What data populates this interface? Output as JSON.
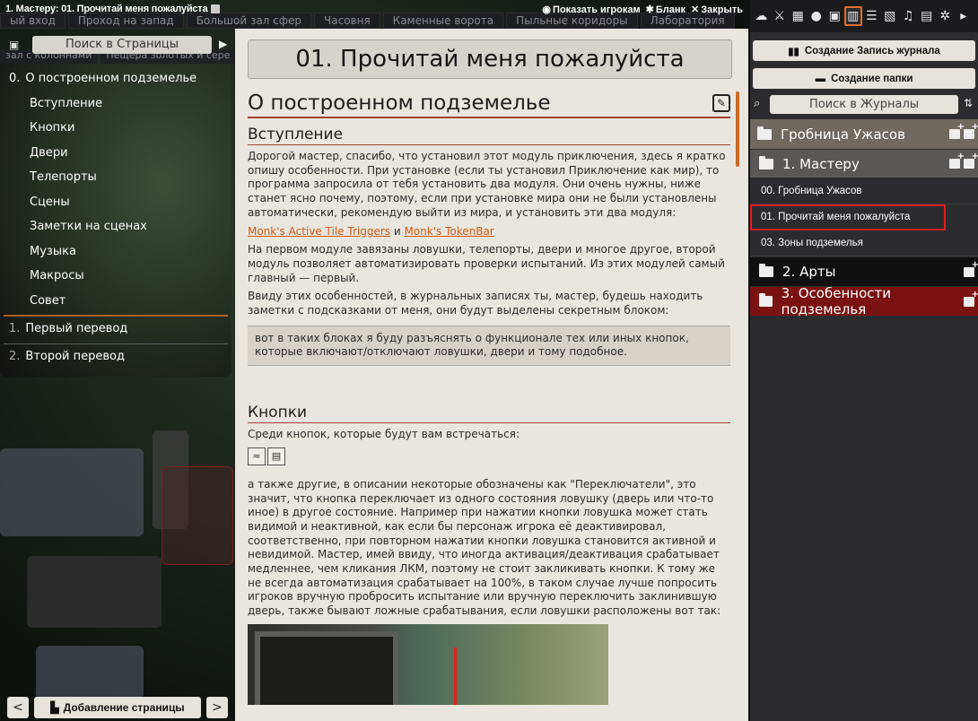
{
  "window": {
    "title": "1. Мастеру: 01. Прочитай меня пожалуйста",
    "actions": {
      "show_players": "Показать игрокам",
      "sheet": "Бланк",
      "close": "Закрыть"
    }
  },
  "scene_tabs": [
    "ый вход",
    "Проход на запад",
    "Большой зал сфер",
    "Часовня",
    "Каменные ворота",
    "Пыльные коридоры",
    "Лаборатория"
  ],
  "scene_tabs_row2": [
    "зал с колоннами",
    "Пещера золотых и сере"
  ],
  "toc": {
    "search_placeholder": "Поиск в Страницы",
    "items": [
      {
        "num": "0.",
        "label": "О построенном подземелье",
        "level": 0
      },
      {
        "num": "",
        "label": "Вступление",
        "level": 1
      },
      {
        "num": "",
        "label": "Кнопки",
        "level": 1
      },
      {
        "num": "",
        "label": "Двери",
        "level": 1
      },
      {
        "num": "",
        "label": "Телепорты",
        "level": 1
      },
      {
        "num": "",
        "label": "Сцены",
        "level": 1
      },
      {
        "num": "",
        "label": "Заметки на сценах",
        "level": 1
      },
      {
        "num": "",
        "label": "Музыка",
        "level": 1
      },
      {
        "num": "",
        "label": "Макросы",
        "level": 1
      },
      {
        "num": "",
        "label": "Совет",
        "level": 1
      }
    ],
    "pages": [
      {
        "num": "1.",
        "label": "Первый перевод"
      },
      {
        "num": "2.",
        "label": "Второй перевод"
      }
    ],
    "add_page": "Добавление страницы",
    "prev": "<",
    "next": ">"
  },
  "page": {
    "title": "01. Прочитай меня пожалуйста",
    "heading": "О построенном подземелье",
    "section1": "Вступление",
    "p1": "Дорогой мастер, спасибо, что установил этот модуль приключения, здесь я кратко опишу особенности. При установке (если ты установил Приключение как мир), то программа запросила от тебя установить два модуля. Они очень нужны, ниже станет ясно почему, поэтому, если при установке мира они не были установлены автоматически, рекомендую выйти из мира, и установить эти два модуля:",
    "link1": "Monk's Active Tile Triggers",
    "link_and": " и ",
    "link2": "Monk's TokenBar",
    "p2": "На первом модуле завязаны ловушки, телепорты, двери и многое другое, второй модуль позволяет автоматизировать проверки испытаний. Из этих модулей самый главный — первый.",
    "p3": "Ввиду этих особенностей, в журнальных записях ты, мастер, будешь находить заметки с подсказками от меня, они будут выделены секретным блоком:",
    "secret": "вот в таких блоках я буду разъяснять о функционале тех или иных кнопок, которые включают/отключают ловушки, двери и тому подобное.",
    "section2": "Кнопки",
    "p4": "Среди кнопок, которые будут вам встречаться:",
    "p5": "а также другие, в описании некоторые обозначены как \"Переключатели\", это значит, что кнопка переключает из одного состояния ловушку (дверь или что-то иное) в другое состояние. Например при нажатии кнопки ловушка может стать видимой и неактивной, как если бы персонаж игрока её деактивировал, соответственно, при повторном нажатии кнопки ловушка становится активной и невидимой. Мастер, имей ввиду, что иногда активация/деактивация срабатывает медленнее, чем кликания ЛКМ, поэтому не стоит закликивать кнопки. К тому же не всегда автоматизация срабатывает на 100%, в таком случае лучше попросить игроков вручную пробросить испытание или вручную переключить заклинившую дверь, также бывают ложные срабатывания, если ловушки расположены вот так:"
  },
  "sidebar": {
    "create_entry": "Создание Запись журнала",
    "create_folder": "Создание папки",
    "search_placeholder": "Поиск в Журналы",
    "folders": [
      {
        "label": "Гробница Ужасов"
      },
      {
        "label": "1. Мастеру"
      },
      {
        "label": "2. Арты"
      },
      {
        "label": "3. Особенности подземелья"
      }
    ],
    "entries": [
      {
        "label": "00. Гробница Ужасов"
      },
      {
        "label": "01. Прочитай меня пожалуйста"
      },
      {
        "label": "03. Зоны подземелья"
      }
    ],
    "tabs": [
      "chat-icon",
      "combat-icon",
      "scenes-icon",
      "actors-icon",
      "items-icon",
      "journal-icon",
      "tables-icon",
      "cards-icon",
      "playlists-icon",
      "compendium-icon",
      "settings-icon",
      "collapse-icon"
    ]
  },
  "colors": {
    "accent": "#e5702a",
    "folder_gold": "#6f6960",
    "folder_master": "#5a5856",
    "folder_arts": "#101010",
    "folder_special": "#7a1212",
    "highlight": "#e61c1c",
    "link": "#d15a12"
  }
}
